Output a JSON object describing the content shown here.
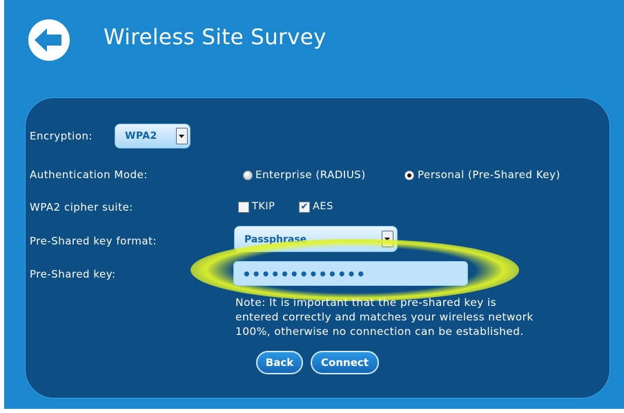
{
  "header": {
    "title": "Wireless Site Survey",
    "back_icon": "back-arrow-icon"
  },
  "form": {
    "encryption": {
      "label": "Encryption:",
      "value": "WPA2"
    },
    "auth_mode": {
      "label": "Authentication Mode:",
      "options": [
        {
          "label": "Enterprise (RADIUS)",
          "selected": false
        },
        {
          "label": "Personal (Pre-Shared Key)",
          "selected": true
        }
      ]
    },
    "cipher": {
      "label": "WPA2 cipher suite:",
      "options": [
        {
          "label": "TKIP",
          "checked": false
        },
        {
          "label": "AES",
          "checked": true
        }
      ]
    },
    "key_format": {
      "label": "Pre-Shared key format:",
      "value": "Passphrase"
    },
    "psk": {
      "label": "Pre-Shared key:",
      "value": "•••••••••••••"
    },
    "note_lines": [
      "Note: It is important that the pre-shared key is",
      "entered correctly and matches your wireless network",
      "100%, otherwise no connection can be established."
    ]
  },
  "buttons": {
    "back": "Back",
    "connect": "Connect"
  },
  "colors": {
    "background": "#1b87cf",
    "panel": "#0d4e84",
    "highlight_glow": "#e1f528"
  }
}
